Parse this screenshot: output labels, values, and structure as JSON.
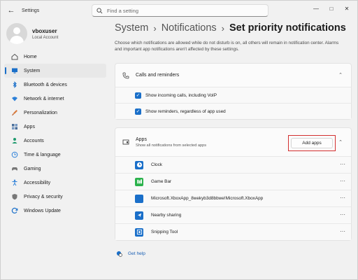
{
  "window": {
    "title": "Settings"
  },
  "search": {
    "placeholder": "Find a setting"
  },
  "profile": {
    "name": "vboxuser",
    "account": "Local Account"
  },
  "nav": [
    {
      "label": "Home",
      "icon": "home-icon",
      "color": "#555555"
    },
    {
      "label": "System",
      "icon": "monitor-icon",
      "color": "#1a6fc9",
      "active": true
    },
    {
      "label": "Bluetooth & devices",
      "icon": "bluetooth-icon",
      "color": "#1a6fc9"
    },
    {
      "label": "Network & internet",
      "icon": "wifi-icon",
      "color": "#2b7fd8"
    },
    {
      "label": "Personalization",
      "icon": "brush-icon",
      "color": "#d97a3c"
    },
    {
      "label": "Apps",
      "icon": "apps-icon",
      "color": "#4b6f9a"
    },
    {
      "label": "Accounts",
      "icon": "person-icon",
      "color": "#1f9a6e"
    },
    {
      "label": "Time & language",
      "icon": "globe-clock-icon",
      "color": "#2b7fd8"
    },
    {
      "label": "Gaming",
      "icon": "controller-icon",
      "color": "#777777"
    },
    {
      "label": "Accessibility",
      "icon": "accessibility-icon",
      "color": "#2b7fd8"
    },
    {
      "label": "Privacy & security",
      "icon": "shield-icon",
      "color": "#777777"
    },
    {
      "label": "Windows Update",
      "icon": "update-icon",
      "color": "#1a6fc9"
    }
  ],
  "breadcrumb": {
    "part1": "System",
    "part2": "Notifications",
    "current": "Set priority notifications"
  },
  "description": "Choose which notifications are allowed while do not disturb is on, all others will remain in notification center. Alarms and important app notifications aren't affected by these settings.",
  "calls": {
    "title": "Calls and reminders",
    "options": [
      {
        "label": "Show incoming calls, including VoIP",
        "checked": true
      },
      {
        "label": "Show reminders, regardless of app used",
        "checked": true
      }
    ]
  },
  "apps": {
    "title": "Apps",
    "subtitle": "Show all notifications from selected apps",
    "add_label": "Add apps",
    "items": [
      {
        "label": "Clock",
        "icon": "clock-icon",
        "color": "#1a6fc9"
      },
      {
        "label": "Game Bar",
        "icon": "gamebar-icon",
        "color": "#2bb24c"
      },
      {
        "label": "Microsoft.XboxApp_8wekyb3d8bbwe!Microsoft.XboxApp",
        "icon": "xbox-app-icon",
        "color": "#1a6fc9"
      },
      {
        "label": "Nearby sharing",
        "icon": "nearby-sharing-icon",
        "color": "#1a6fc9"
      },
      {
        "label": "Snipping Tool",
        "icon": "snipping-tool-icon",
        "color": "#1a6fc9"
      }
    ],
    "more_label": "···"
  },
  "help": {
    "label": "Get help"
  },
  "accent": "#1a6fc9",
  "highlight": "#d32f2f"
}
